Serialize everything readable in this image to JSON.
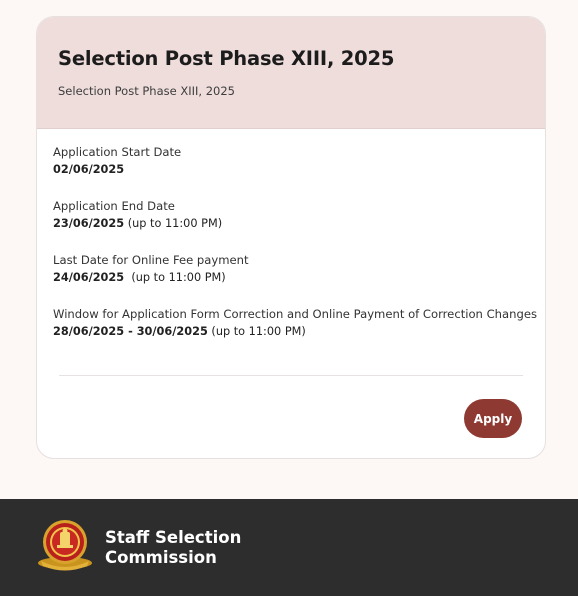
{
  "card": {
    "title": "Selection Post Phase XIII, 2025",
    "subtitle": "Selection Post Phase XIII, 2025",
    "items": [
      {
        "label": "Application Start Date",
        "value_bold": "02/06/2025",
        "value_rest": ""
      },
      {
        "label": "Application End Date",
        "value_bold": "23/06/2025",
        "value_rest": " (up to 11:00 PM)"
      },
      {
        "label": "Last Date for Online Fee payment",
        "value_bold": "24/06/2025",
        "value_rest": "  (up to 11:00 PM)"
      },
      {
        "label": "Window for Application Form Correction and Online Payment of Correction Changes",
        "value_bold": "28/06/2025 - 30/06/2025",
        "value_rest": " (up to 11:00 PM)"
      }
    ],
    "apply_label": "Apply"
  },
  "footer": {
    "org_line1": "Staff Selection",
    "org_line2": "Commission",
    "logo_icon": "ssc-emblem-logo"
  },
  "colors": {
    "header_bg": "#efdddc",
    "accent": "#8e3a32",
    "footer_bg": "#2d2d2d",
    "page_bg": "#fdf8f6"
  }
}
